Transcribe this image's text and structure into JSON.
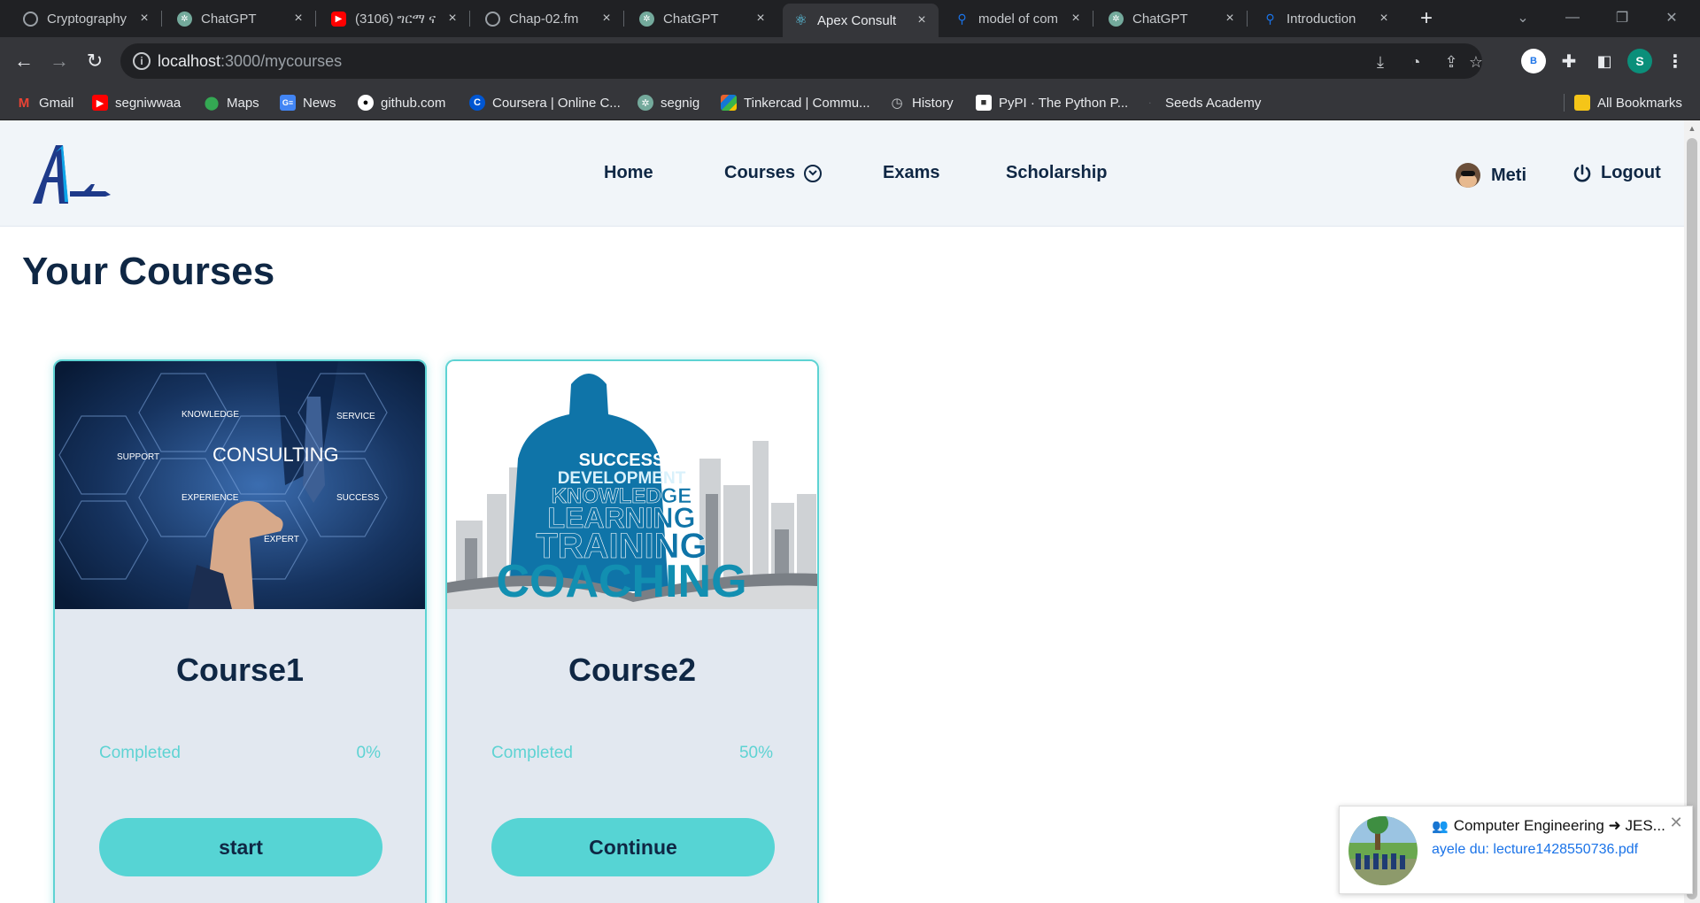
{
  "browser": {
    "tabs": [
      {
        "title": "Cryptography",
        "favicon": "globe-icon",
        "color": "#5f6368"
      },
      {
        "title": "ChatGPT",
        "favicon": "chatgpt-icon",
        "color": "#74aa9c"
      },
      {
        "title": "(3106) ግርማ ና",
        "favicon": "youtube-icon",
        "color": "#ff0000"
      },
      {
        "title": "Chap-02.fm",
        "favicon": "globe-icon",
        "color": "#5f6368"
      },
      {
        "title": "ChatGPT",
        "favicon": "chatgpt-icon",
        "color": "#74aa9c"
      },
      {
        "title": "Apex Consult",
        "favicon": "react-icon",
        "color": "#61dafb"
      },
      {
        "title": "model of com",
        "favicon": "search-icon",
        "color": "#1a73e8"
      },
      {
        "title": "ChatGPT",
        "favicon": "chatgpt-icon",
        "color": "#74aa9c"
      },
      {
        "title": "Introduction",
        "favicon": "search-icon",
        "color": "#1a73e8"
      }
    ],
    "active_tab_index": 5,
    "url_host": "localhost",
    "url_path": ":3000/mycourses",
    "profile_letter_b": "B",
    "profile_letter_s": "S",
    "bookmarks": [
      {
        "label": "Gmail",
        "icon": "gmail-icon",
        "color": "#ea4335"
      },
      {
        "label": "segniwwaa",
        "icon": "youtube-icon",
        "color": "#ff0000"
      },
      {
        "label": "Maps",
        "icon": "maps-icon",
        "color": "#34a853"
      },
      {
        "label": "News",
        "icon": "news-icon",
        "color": "#4285f4"
      },
      {
        "label": "github.com",
        "icon": "github-icon",
        "color": "#ffffff"
      },
      {
        "label": "Coursera | Online C...",
        "icon": "coursera-icon",
        "color": "#0056d2"
      },
      {
        "label": "segnig",
        "icon": "chatgpt-icon",
        "color": "#74aa9c"
      },
      {
        "label": "Tinkercad | Commu...",
        "icon": "tinkercad-icon",
        "color": "#e8622d"
      },
      {
        "label": "History",
        "icon": "history-icon",
        "color": "#c6c9cc"
      },
      {
        "label": "PyPI · The Python P...",
        "icon": "pypi-icon",
        "color": "#ffffff"
      },
      {
        "label": "Seeds Academy",
        "icon": "seeds-icon",
        "color": "#35363a"
      }
    ],
    "all_bookmarks_label": "All Bookmarks"
  },
  "site": {
    "nav": {
      "home": "Home",
      "courses": "Courses",
      "exams": "Exams",
      "scholarship": "Scholarship"
    },
    "user_name": "Meti",
    "logout_label": "Logout",
    "accent_color": "#56d4d4",
    "text_color": "#0f2744"
  },
  "page": {
    "title": "Your Courses"
  },
  "courses": [
    {
      "name": "Course1",
      "progress_label": "Completed",
      "progress": "0%",
      "button_label": "start",
      "image_words": [
        "KNOWLEDGE",
        "SERVICE",
        "SUPPORT",
        "CONSULTING",
        "EXPERIENCE",
        "SUCCESS",
        "EXPERT"
      ]
    },
    {
      "name": "Course2",
      "progress_label": "Completed",
      "progress": "50%",
      "button_label": "Continue",
      "image_words": [
        "SUCCESS",
        "DEVELOPMENT",
        "KNOWLEDGE",
        "LEARNING",
        "TRAINING",
        "COACHING"
      ]
    }
  ],
  "notification": {
    "group": "Computer Engineering ➜ JES...",
    "message": "ayele du: lecture1428550736.pdf"
  }
}
